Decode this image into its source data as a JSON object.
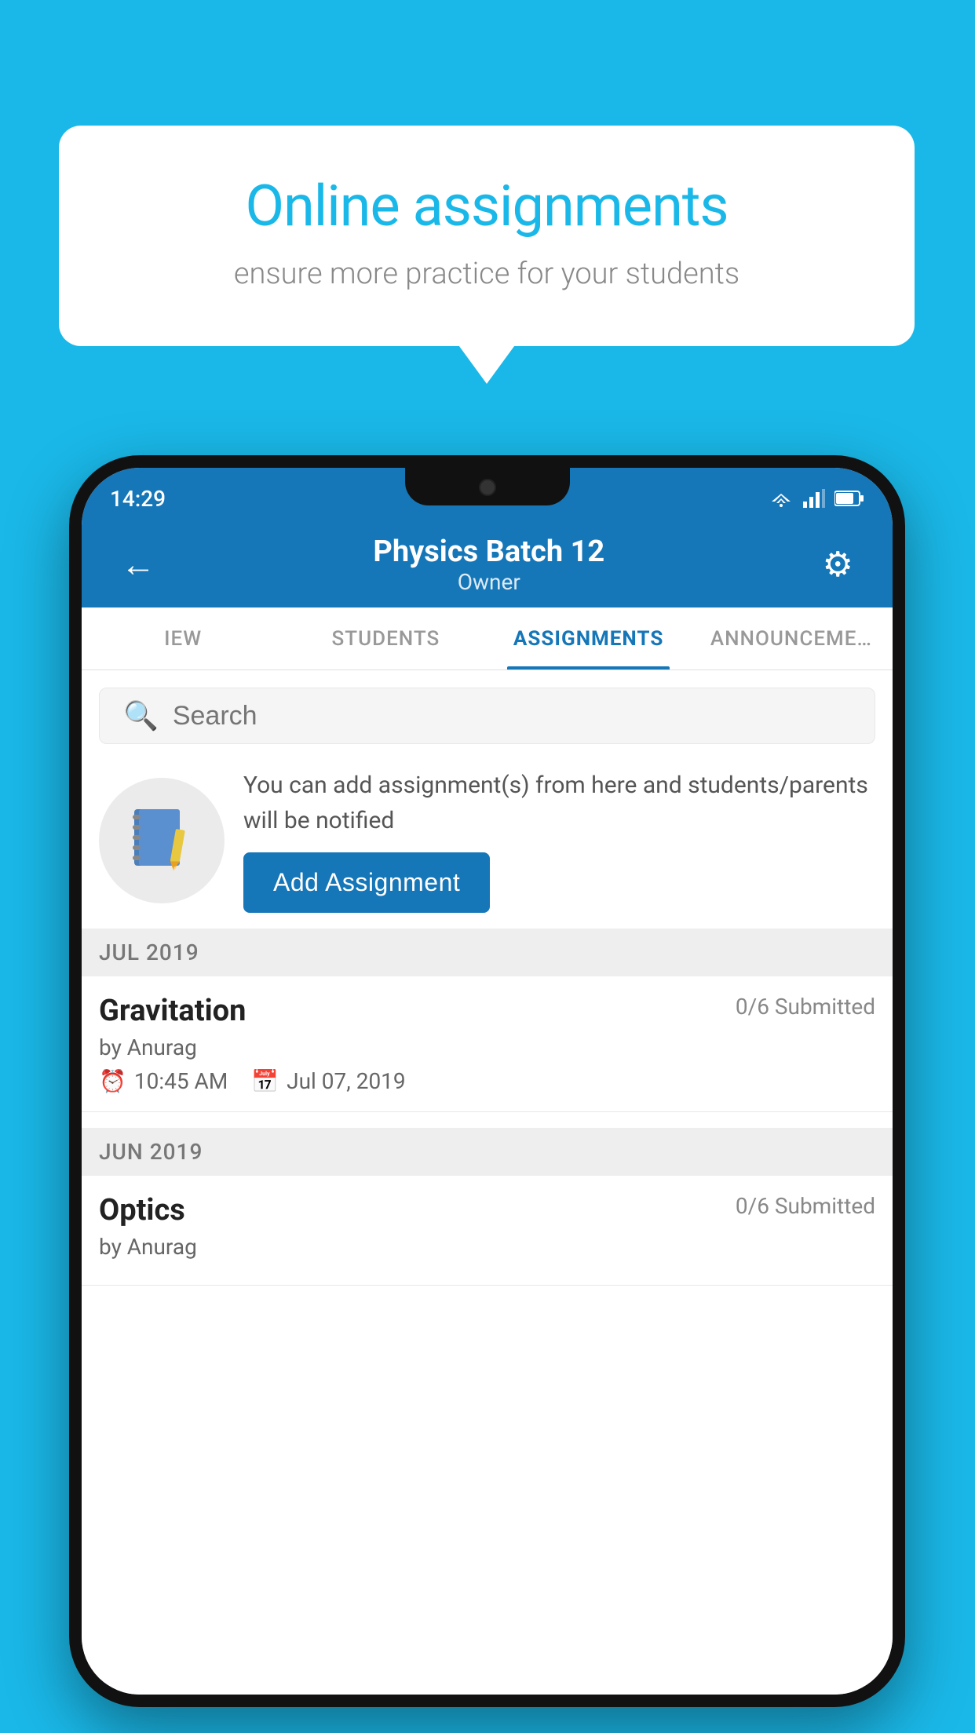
{
  "background_color": "#1ab8e8",
  "speech_bubble": {
    "title": "Online assignments",
    "subtitle": "ensure more practice for your students"
  },
  "phone": {
    "status_bar": {
      "time": "14:29"
    },
    "app_bar": {
      "title": "Physics Batch 12",
      "subtitle": "Owner",
      "back_label": "←",
      "settings_label": "⚙"
    },
    "tabs": [
      {
        "label": "IEW",
        "active": false
      },
      {
        "label": "STUDENTS",
        "active": false
      },
      {
        "label": "ASSIGNMENTS",
        "active": true
      },
      {
        "label": "ANNOUNCEMENTS",
        "active": false
      }
    ],
    "search": {
      "placeholder": "Search"
    },
    "promo": {
      "text": "You can add assignment(s) from here and students/parents will be notified",
      "button_label": "Add Assignment"
    },
    "sections": [
      {
        "month": "JUL 2019",
        "assignments": [
          {
            "name": "Gravitation",
            "submitted": "0/6 Submitted",
            "author": "by Anurag",
            "time": "10:45 AM",
            "date": "Jul 07, 2019"
          }
        ]
      },
      {
        "month": "JUN 2019",
        "assignments": [
          {
            "name": "Optics",
            "submitted": "0/6 Submitted",
            "author": "by Anurag",
            "time": "",
            "date": ""
          }
        ]
      }
    ]
  }
}
